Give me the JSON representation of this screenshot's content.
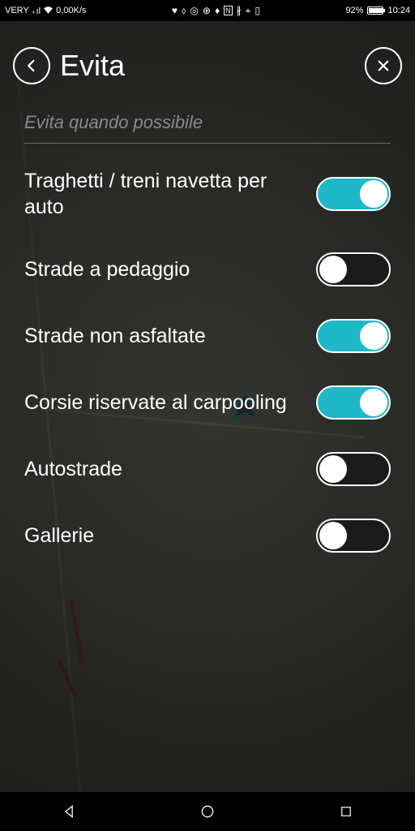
{
  "status": {
    "carrier": "VERY",
    "data_rate": "0,00K/s",
    "battery_pct": "92%",
    "time": "10:24"
  },
  "header": {
    "title": "Evita"
  },
  "section": {
    "heading": "Evita quando possibile"
  },
  "options": [
    {
      "label": "Traghetti / treni navetta per auto",
      "on": true
    },
    {
      "label": "Strade a pedaggio",
      "on": false
    },
    {
      "label": "Strade non asfaltate",
      "on": true
    },
    {
      "label": "Corsie riservate al carpooling",
      "on": true
    },
    {
      "label": "Autostrade",
      "on": false
    },
    {
      "label": "Gallerie",
      "on": false
    }
  ]
}
